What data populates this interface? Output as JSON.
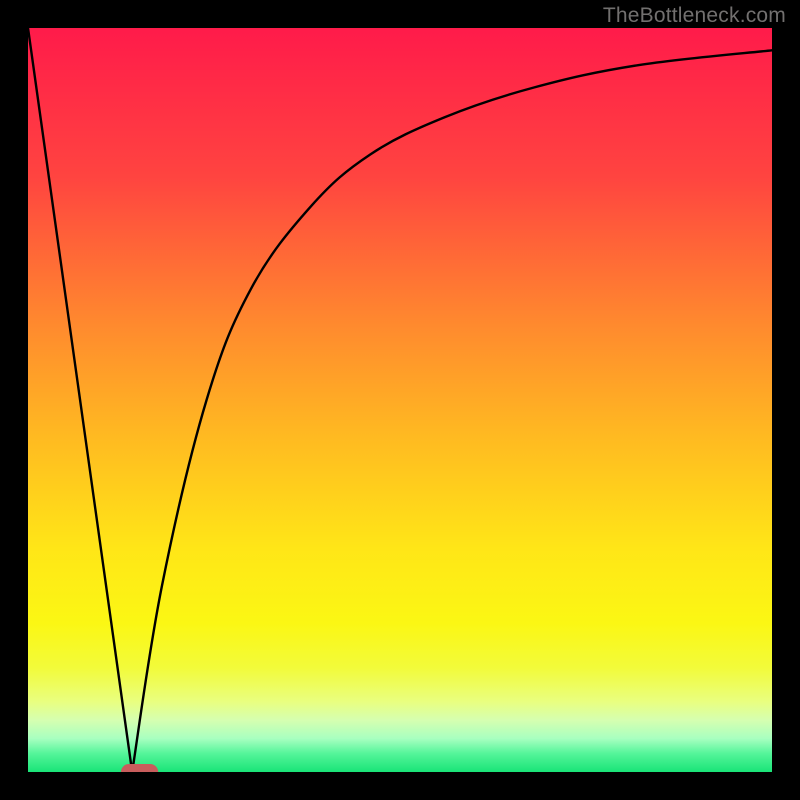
{
  "attribution": "TheBottleneck.com",
  "chart_data": {
    "type": "line",
    "title": "",
    "xlabel": "",
    "ylabel": "",
    "xlim": [
      0,
      100
    ],
    "ylim": [
      0,
      100
    ],
    "grid": false,
    "legend": false,
    "annotations": [],
    "series": [
      {
        "name": "bottleneck-curve",
        "x": [
          0,
          14,
          18,
          24,
          30,
          38,
          46,
          56,
          68,
          82,
          100
        ],
        "y": [
          100,
          0,
          25,
          50,
          65,
          76,
          83,
          88,
          92,
          95,
          97
        ]
      }
    ],
    "marker": {
      "x_range": [
        12.5,
        17.5
      ],
      "y": 0
    },
    "background_gradient": {
      "stops": [
        {
          "offset": 0.0,
          "color": "#ff1b4a"
        },
        {
          "offset": 0.2,
          "color": "#ff4440"
        },
        {
          "offset": 0.4,
          "color": "#ff8a2e"
        },
        {
          "offset": 0.55,
          "color": "#ffba21"
        },
        {
          "offset": 0.7,
          "color": "#ffe617"
        },
        {
          "offset": 0.8,
          "color": "#fbf714"
        },
        {
          "offset": 0.86,
          "color": "#f2fb3a"
        },
        {
          "offset": 0.905,
          "color": "#e9ff7f"
        },
        {
          "offset": 0.93,
          "color": "#d6ffb0"
        },
        {
          "offset": 0.955,
          "color": "#a8ffc0"
        },
        {
          "offset": 0.975,
          "color": "#55f59a"
        },
        {
          "offset": 1.0,
          "color": "#19e477"
        }
      ]
    },
    "marker_fill": "#c85d5c"
  }
}
